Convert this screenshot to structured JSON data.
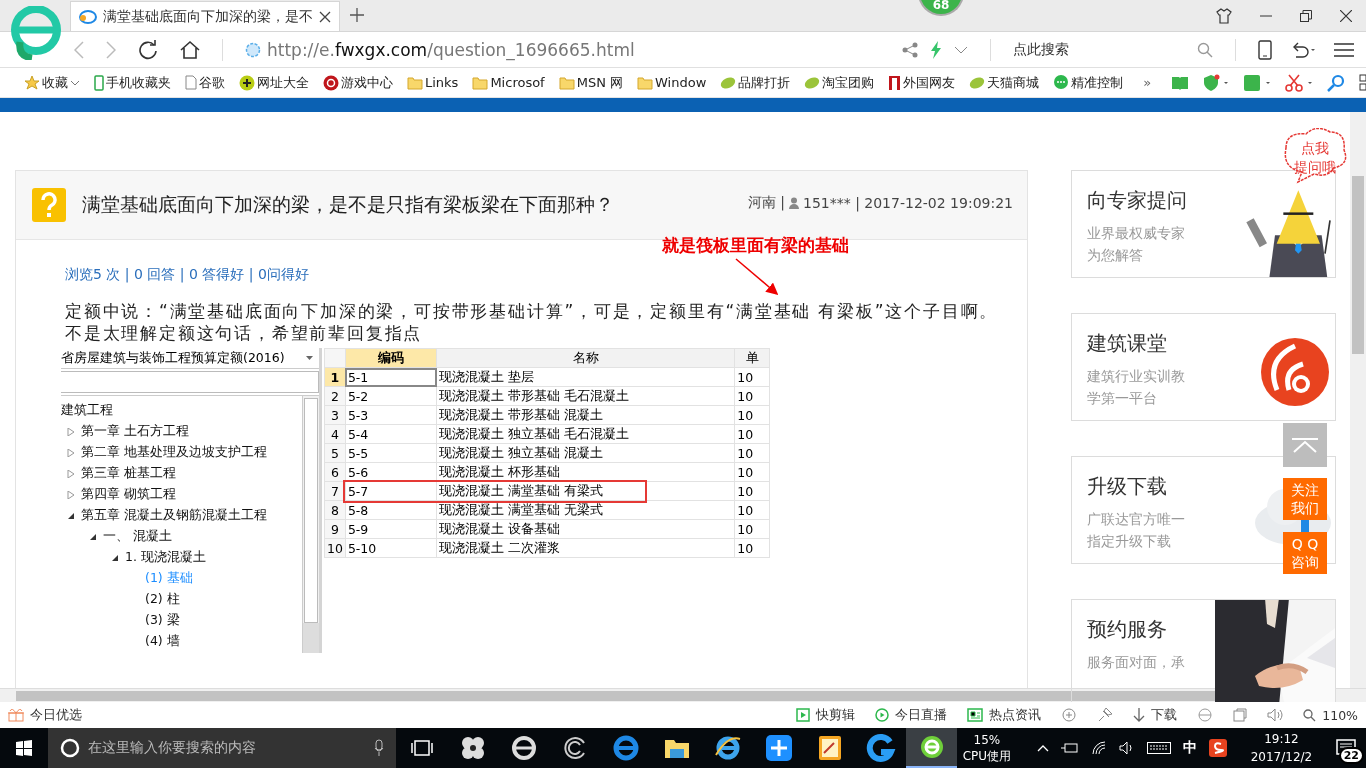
{
  "browser": {
    "tab_title": "满堂基础底面向下加深的梁，是不",
    "badge": "68",
    "url": {
      "prefix": "http://e.",
      "domain": "fwxgx.com",
      "path": "/question_1696665.html"
    },
    "search_placeholder": "点此搜索",
    "bookmarks": [
      {
        "label": "收藏",
        "kind": "star"
      },
      {
        "label": "手机收藏夹",
        "kind": "phone"
      },
      {
        "label": "谷歌",
        "kind": "page"
      },
      {
        "label": "网址大全",
        "kind": "plus"
      },
      {
        "label": "游戏中心",
        "kind": "game"
      },
      {
        "label": "Links",
        "kind": "folder"
      },
      {
        "label": "Microsof",
        "kind": "folder"
      },
      {
        "label": "MSN 网",
        "kind": "folder"
      },
      {
        "label": "Window",
        "kind": "folder"
      },
      {
        "label": "品牌打折",
        "kind": "leaf"
      },
      {
        "label": "淘宝团购",
        "kind": "leaf"
      },
      {
        "label": "外国网友",
        "kind": "book"
      },
      {
        "label": "天猫商城",
        "kind": "leaf"
      },
      {
        "label": "精准控制",
        "kind": "chat"
      }
    ],
    "more": "»"
  },
  "question": {
    "title": "满堂基础底面向下加深的梁，是不是只指有梁板梁在下面那种？",
    "meta_location": "河南 |",
    "meta_user": "151*** | 2017-12-02 19:09:21",
    "annotation": "就是筏板里面有梁的基础",
    "stats": "浏览5 次 | 0 回答 | 0 答得好 | 0问得好",
    "body": "定额中说：“满堂基础底面向下加深的梁，可按带形基础计算”，可是，定额里有“满堂基础 有梁板”这个子目啊。不是太理解定额这句话，希望前辈回复指点",
    "screenshot": {
      "dropdown": "省房屋建筑与装饰工程预算定额(2016)",
      "tree": [
        {
          "label": "建筑工程",
          "children": [
            {
              "label": "第一章  土石方工程",
              "expanded": false
            },
            {
              "label": "第二章  地基处理及边坡支护工程",
              "expanded": false
            },
            {
              "label": "第三章  桩基工程",
              "expanded": false
            },
            {
              "label": "第四章  砌筑工程",
              "expanded": false
            },
            {
              "label": "第五章  混凝土及钢筋混凝土工程",
              "expanded": true,
              "children": [
                {
                  "label": "一、  混凝土",
                  "expanded": true,
                  "children": [
                    {
                      "label": "1.  现浇混凝土",
                      "expanded": true,
                      "children": [
                        {
                          "label": "(1) 基础",
                          "selected": true
                        },
                        {
                          "label": "(2) 柱",
                          "selected": false
                        },
                        {
                          "label": "(3) 梁",
                          "selected": false
                        },
                        {
                          "label": "(4) 墙",
                          "selected": false
                        }
                      ]
                    }
                  ]
                }
              ]
            }
          ]
        }
      ],
      "columns": [
        "编码",
        "名称",
        "单"
      ],
      "rows": [
        {
          "num": "1",
          "code": "5-1",
          "name": "现浇混凝土  垫层",
          "unit": "10",
          "selected": true,
          "boxed": false
        },
        {
          "num": "2",
          "code": "5-2",
          "name": "现浇混凝土  带形基础  毛石混凝土",
          "unit": "10",
          "selected": false,
          "boxed": false
        },
        {
          "num": "3",
          "code": "5-3",
          "name": "现浇混凝土  带形基础  混凝土",
          "unit": "10",
          "selected": false,
          "boxed": false
        },
        {
          "num": "4",
          "code": "5-4",
          "name": "现浇混凝土  独立基础  毛石混凝土",
          "unit": "10",
          "selected": false,
          "boxed": false
        },
        {
          "num": "5",
          "code": "5-5",
          "name": "现浇混凝土  独立基础  混凝土",
          "unit": "10",
          "selected": false,
          "boxed": false
        },
        {
          "num": "6",
          "code": "5-6",
          "name": "现浇混凝土  杯形基础",
          "unit": "10",
          "selected": false,
          "boxed": false
        },
        {
          "num": "7",
          "code": "5-7",
          "name": "现浇混凝土  满堂基础  有梁式",
          "unit": "10",
          "selected": false,
          "boxed": true
        },
        {
          "num": "8",
          "code": "5-8",
          "name": "现浇混凝土  满堂基础  无梁式",
          "unit": "10",
          "selected": false,
          "boxed": false
        },
        {
          "num": "9",
          "code": "5-9",
          "name": "现浇混凝土  设备基础",
          "unit": "10",
          "selected": false,
          "boxed": false
        },
        {
          "num": "10",
          "code": "5-10",
          "name": "现浇混凝土  二次灌浆",
          "unit": "10",
          "selected": false,
          "boxed": false
        }
      ]
    }
  },
  "sidebar": [
    {
      "title": "向专家提问",
      "desc": [
        "业界最权威专家",
        "为您解答"
      ],
      "kind": "mascot"
    },
    {
      "title": "建筑课堂",
      "desc": [
        "建筑行业实训教",
        "学第一平台"
      ],
      "kind": "logo"
    },
    {
      "title": "升级下载",
      "desc": [
        "广联达官方唯一",
        "指定升级下载"
      ],
      "kind": "cloud"
    },
    {
      "title": "预约服务",
      "desc": [
        "服务面对面，承"
      ]
    }
  ],
  "floating": {
    "bubble": [
      "点我",
      "提问哦"
    ],
    "follow": [
      "关注",
      "我们"
    ],
    "qq": [
      "Q Q",
      "咨询"
    ]
  },
  "status_bar": {
    "left": "今日优选",
    "items": [
      {
        "label": "快剪辑",
        "kind": "clip"
      },
      {
        "label": "今日直播",
        "kind": "live"
      },
      {
        "label": "热点资讯",
        "kind": "news"
      },
      {
        "label": "下载",
        "kind": "download"
      }
    ],
    "zoom": "110%"
  },
  "taskbar": {
    "search_placeholder": "在这里输入你要搜索的内容",
    "apps": [
      {
        "kind": "taskview",
        "active": false
      },
      {
        "kind": "fan",
        "active": false
      },
      {
        "kind": "ie-gray",
        "active": false
      },
      {
        "kind": "swirl",
        "active": false
      },
      {
        "kind": "edge",
        "active": false
      },
      {
        "kind": "folder",
        "active": false
      },
      {
        "kind": "ie",
        "active": false
      },
      {
        "kind": "cross",
        "active": false
      },
      {
        "kind": "notes",
        "active": false
      },
      {
        "kind": "g",
        "active": false
      },
      {
        "kind": "green-e",
        "active": true
      }
    ],
    "cpu": "15%",
    "cpu_label": "CPU使用",
    "ime": "中",
    "time": "19:12",
    "date": "2017/12/2",
    "notifications": "22"
  }
}
